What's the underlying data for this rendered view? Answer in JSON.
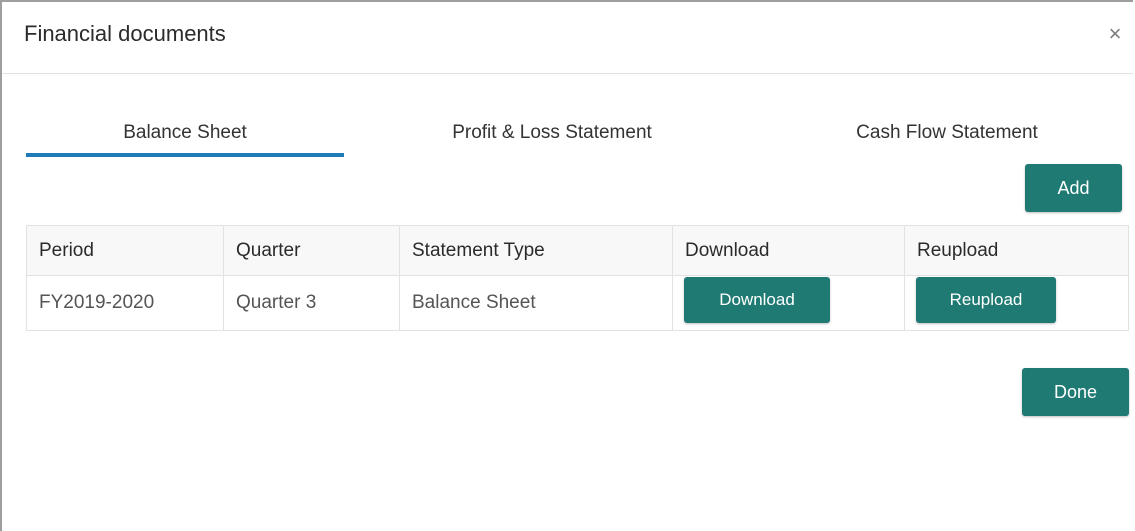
{
  "dialog": {
    "title": "Financial documents",
    "close_icon": "close-icon",
    "close_glyph": "×"
  },
  "tabs": [
    {
      "label": "Balance Sheet",
      "active": true
    },
    {
      "label": "Profit & Loss Statement",
      "active": false
    },
    {
      "label": "Cash Flow Statement",
      "active": false
    }
  ],
  "actions": {
    "add_label": "Add",
    "done_label": "Done"
  },
  "table": {
    "headers": [
      "Period",
      "Quarter",
      "Statement Type",
      "Download",
      "Reupload"
    ],
    "rows": [
      {
        "period": "FY2019-2020",
        "quarter": "Quarter 3",
        "statement_type": "Balance Sheet",
        "download_label": "Download",
        "reupload_label": "Reupload"
      }
    ]
  },
  "colors": {
    "accent": "#1f7a73",
    "tab_indicator": "#1f7ab8"
  }
}
